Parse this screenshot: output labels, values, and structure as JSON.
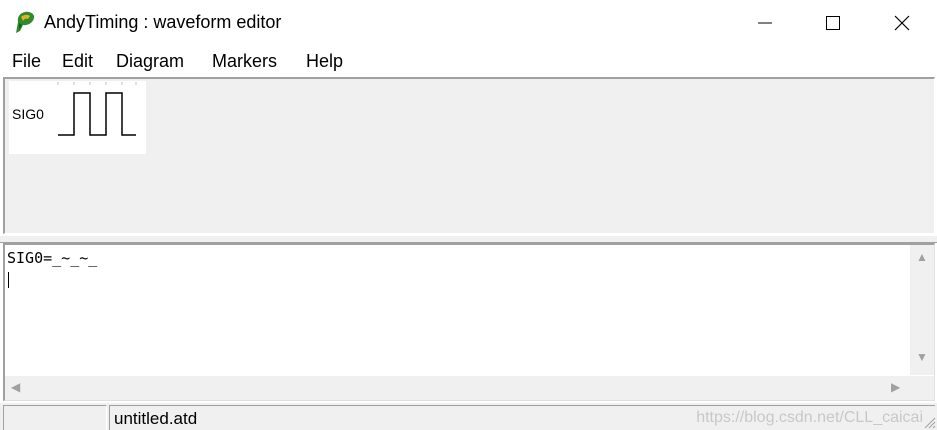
{
  "window": {
    "title": "AndyTiming : waveform editor"
  },
  "menu": [
    "File",
    "Edit",
    "Diagram",
    "Markers",
    "Help"
  ],
  "waveform": {
    "signals": [
      {
        "name": "SIG0",
        "pattern": "_~_~_"
      }
    ]
  },
  "editor": {
    "lines": [
      "SIG0=_~_~_"
    ]
  },
  "status": {
    "left": "",
    "filename": "untitled.atd"
  },
  "watermark": "https://blog.csdn.net/CLL_caicai",
  "icons": {
    "app": "andytiming-app-icon",
    "minimize": "minimize-icon",
    "maximize": "maximize-icon",
    "close": "close-icon"
  }
}
